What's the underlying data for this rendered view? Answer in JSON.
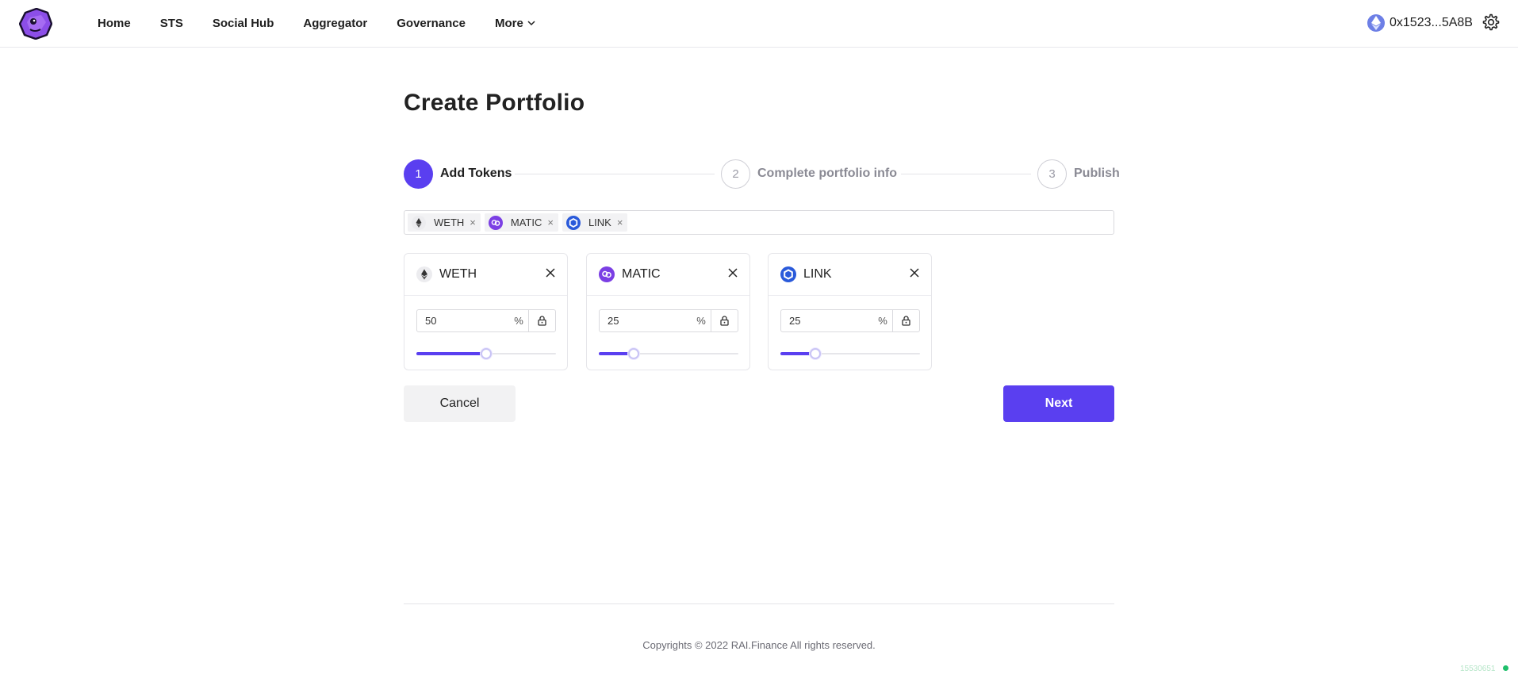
{
  "header": {
    "nav": [
      {
        "id": "home",
        "label": "Home"
      },
      {
        "id": "sts",
        "label": "STS"
      },
      {
        "id": "social-hub",
        "label": "Social Hub"
      },
      {
        "id": "aggregator",
        "label": "Aggregator"
      },
      {
        "id": "governance",
        "label": "Governance"
      },
      {
        "id": "more",
        "label": "More"
      }
    ],
    "wallet_address": "0x1523...5A8B",
    "wallet_icon": "ethereum-icon",
    "settings_icon": "gear-icon"
  },
  "page": {
    "title": "Create Portfolio"
  },
  "stepper": {
    "steps": [
      {
        "number": "1",
        "label": "Add Tokens",
        "state": "active"
      },
      {
        "number": "2",
        "label": "Complete portfolio info",
        "state": "inactive"
      },
      {
        "number": "3",
        "label": "Publish",
        "state": "inactive"
      }
    ]
  },
  "token_select": {
    "chips": [
      {
        "symbol": "WETH",
        "icon": "ethereum-icon",
        "remove": "×"
      },
      {
        "symbol": "MATIC",
        "icon": "polygon-icon",
        "remove": "×"
      },
      {
        "symbol": "LINK",
        "icon": "chainlink-icon",
        "remove": "×"
      }
    ]
  },
  "tokens": [
    {
      "symbol": "WETH",
      "icon": "ethereum-icon",
      "weight": "50",
      "unit": "%",
      "slider_fraction": 0.5
    },
    {
      "symbol": "MATIC",
      "icon": "polygon-icon",
      "weight": "25",
      "unit": "%",
      "slider_fraction": 0.25
    },
    {
      "symbol": "LINK",
      "icon": "chainlink-icon",
      "weight": "25",
      "unit": "%",
      "slider_fraction": 0.25
    }
  ],
  "actions": {
    "cancel_label": "Cancel",
    "next_label": "Next"
  },
  "footer": {
    "copyright": "Copyrights © 2022 RAI.Finance All rights reserved.",
    "build": "15530651"
  },
  "colors": {
    "accent": "#5a3ff0",
    "polygon": "#7b3fe4",
    "chainlink": "#2a5ada",
    "ethereum_badge": "#6d7fe6",
    "status_ok": "#1fbf6b"
  }
}
